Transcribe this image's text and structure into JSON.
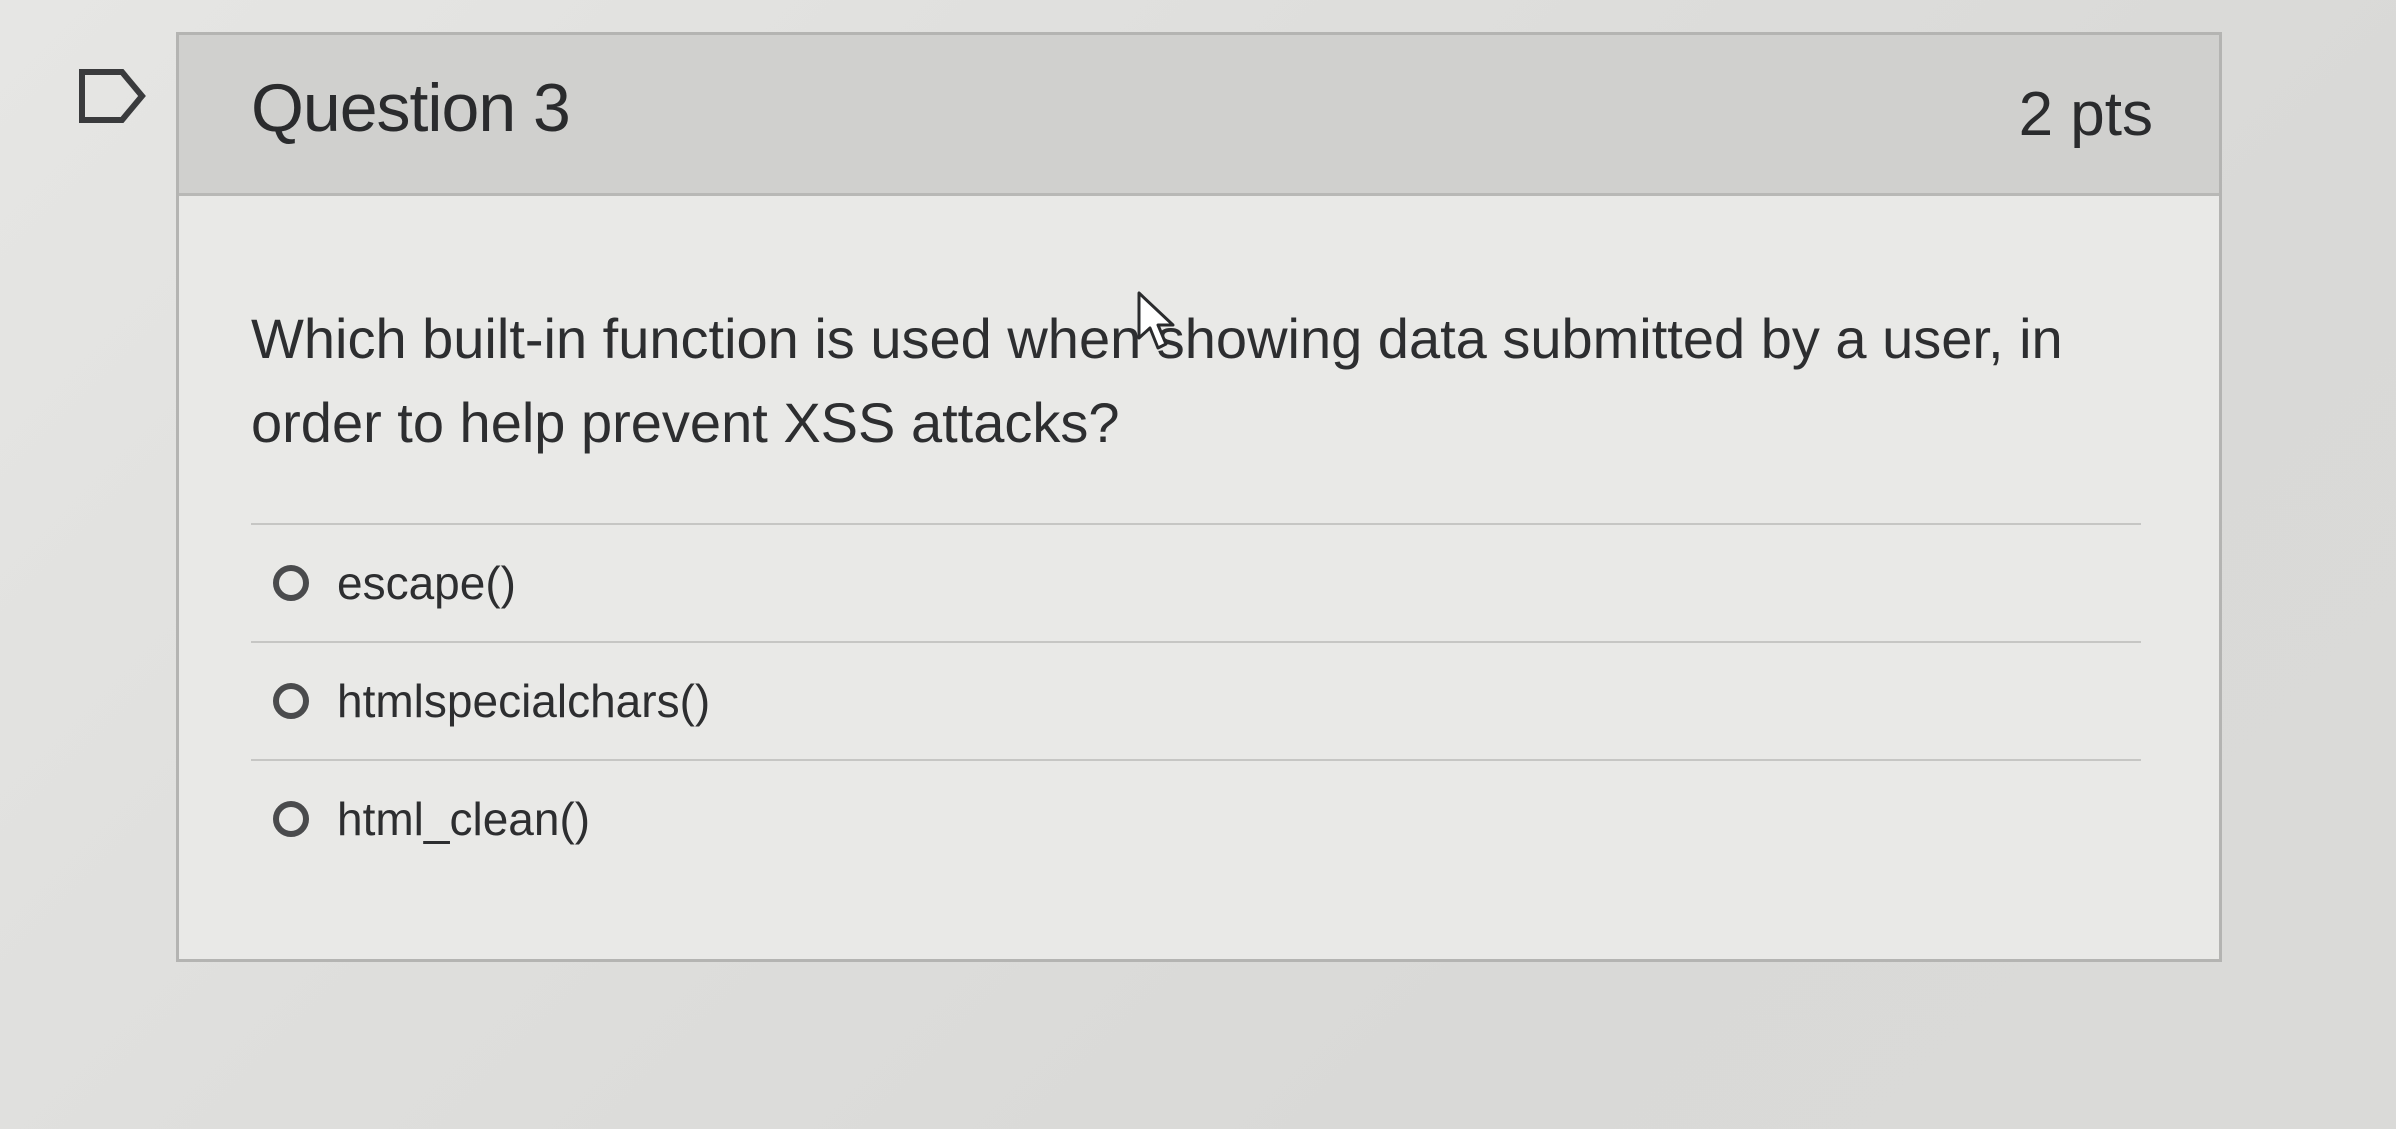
{
  "question": {
    "title": "Question 3",
    "points": "2 pts",
    "text": "Which built-in function is used when showing data submitted by a user, in order to help prevent XSS attacks?",
    "answers": [
      {
        "label": "escape()"
      },
      {
        "label": "htmlspecialchars()"
      },
      {
        "label": "html_clean()"
      }
    ]
  },
  "colors": {
    "header_bg": "#d0d0ce",
    "card_bg": "#e9e9e7",
    "text": "#2a2b2d"
  },
  "icons": {
    "flag": "flag-question-icon",
    "radio": "radio-unselected-icon",
    "cursor": "mouse-pointer-icon"
  }
}
